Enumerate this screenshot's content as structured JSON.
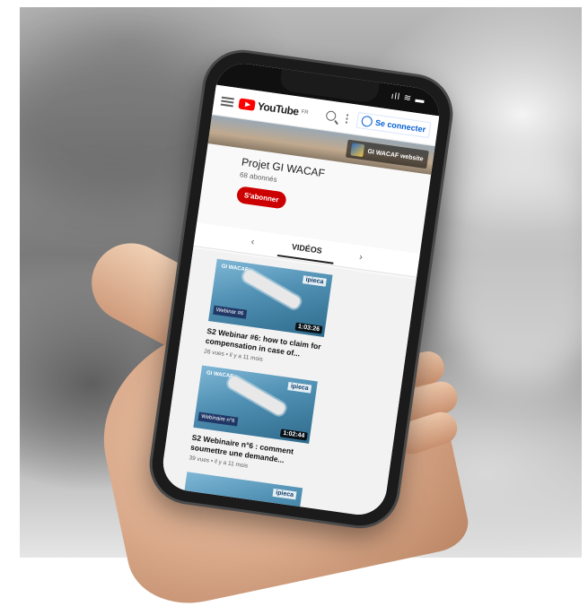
{
  "status_bar": {
    "icons": "ıll ≋ ▬"
  },
  "topbar": {
    "logo_text": "YouTube",
    "region": "FR",
    "signin_label": "Se connecter"
  },
  "banner": {
    "link_label": "GI WACAF website"
  },
  "channel": {
    "name": "Projet GI WACAF",
    "subscribers": "68 abonnés",
    "subscribe_label": "S'abonner"
  },
  "tabs": {
    "active": "VIDÉOS",
    "prev": "‹",
    "next": "›"
  },
  "videos": [
    {
      "thumb_left": "GI WACAF",
      "thumb_right": "ipieca",
      "thumb_label": "Webinar #6",
      "duration": "1:03:26",
      "title": "S2 Webinar #6: how to claim for compensation in case of...",
      "meta": "26 vues • il y a 11 mois"
    },
    {
      "thumb_left": "GI WACAF",
      "thumb_right": "ipieca",
      "thumb_label": "Webinaire n°6",
      "duration": "1:02:44",
      "title": "S2 Webinaire n°6 : comment soumettre une demande...",
      "meta": "39 vues • il y a 11 mois"
    },
    {
      "thumb_left": "",
      "thumb_right": "ipieca",
      "thumb_label": "",
      "duration": "",
      "title": "",
      "meta": ""
    }
  ]
}
